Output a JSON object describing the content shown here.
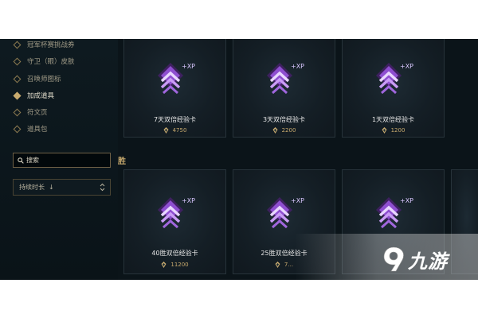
{
  "sidebar": {
    "items": [
      {
        "label": "冠军杯赛挑战券",
        "active": false
      },
      {
        "label": "守卫（眼）皮肤",
        "active": false
      },
      {
        "label": "召唤师图标",
        "active": false
      },
      {
        "label": "加成道具",
        "active": true
      },
      {
        "label": "符文页",
        "active": false
      },
      {
        "label": "道具包",
        "active": false
      }
    ],
    "search": {
      "placeholder": "搜索"
    },
    "sort": {
      "label": "持续时长",
      "direction_glyph": "↓"
    }
  },
  "section_label": "胜",
  "cards": [
    {
      "name": "7天双倍经验卡",
      "price": "4750"
    },
    {
      "name": "3天双倍经验卡",
      "price": "2200"
    },
    {
      "name": "1天双倍经验卡",
      "price": "1200"
    },
    {
      "name": "40胜双倍经验卡",
      "price": "11200"
    },
    {
      "name": "25胜双倍经验卡",
      "price": "7..."
    },
    {
      "name": "",
      "price": ""
    }
  ],
  "badge_text": "+XP",
  "watermark": {
    "text": "九游"
  },
  "colors": {
    "gold": "#c8aa6e",
    "panel": "#0b1419",
    "badge_purple": "#b46ee6"
  }
}
